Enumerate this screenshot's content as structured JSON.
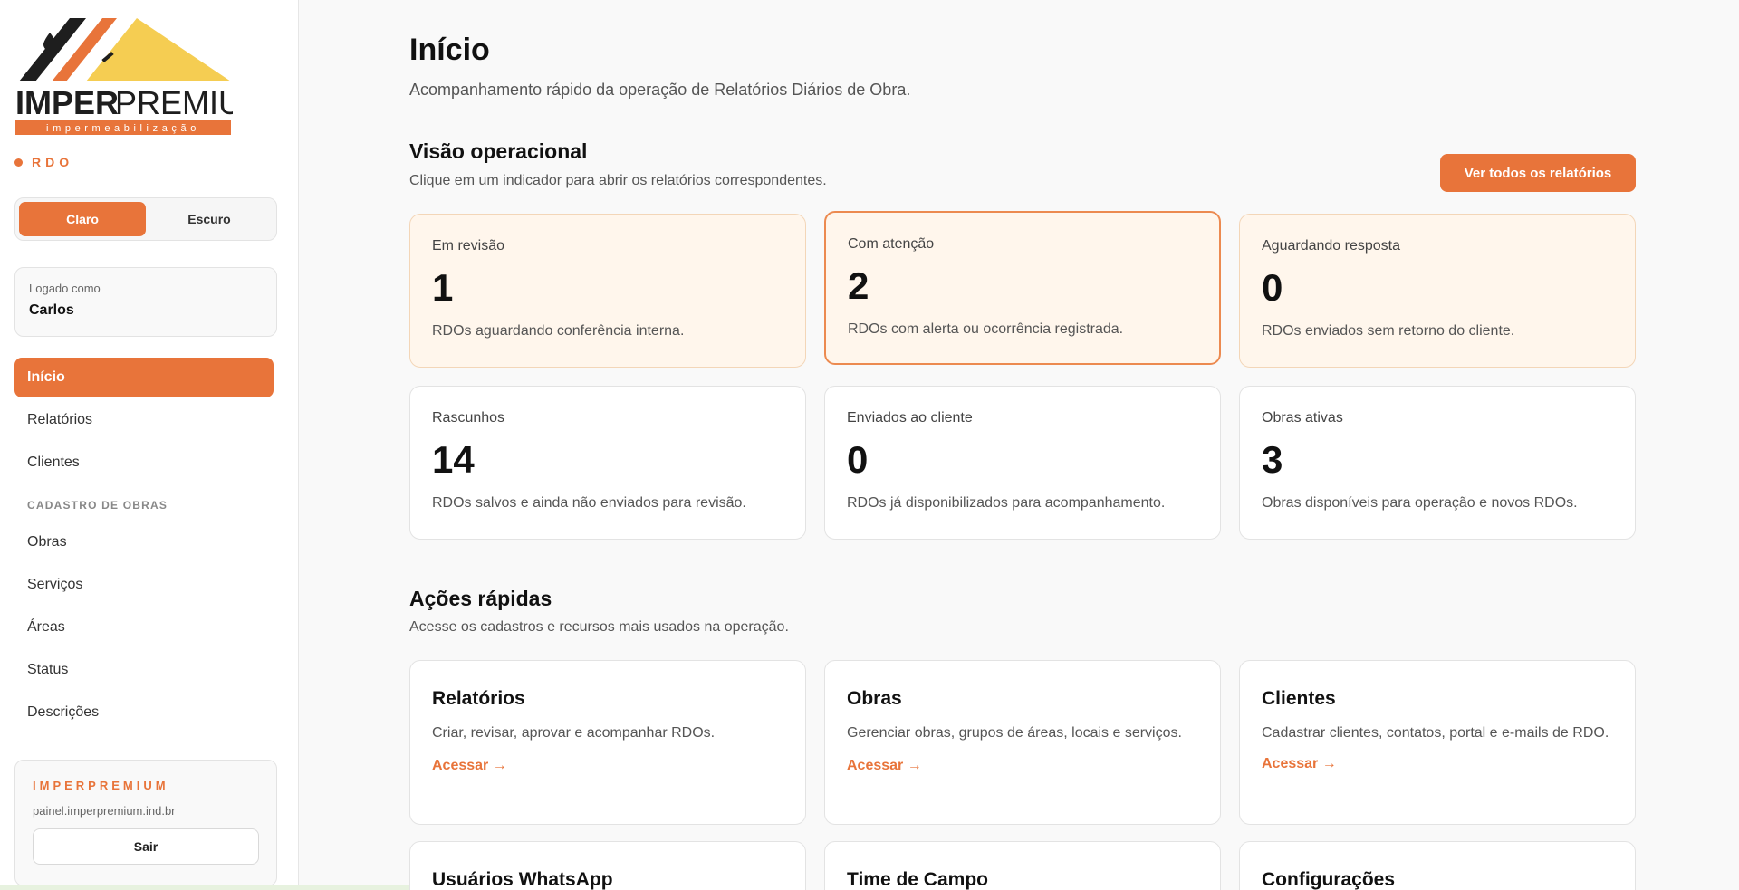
{
  "brand": {
    "logo_main": "IMPER",
    "logo_secondary": "PREMIUM",
    "logo_tagline": "impermeabilização",
    "module": "RDO"
  },
  "theme": {
    "light_label": "Claro",
    "dark_label": "Escuro",
    "selected": "Claro"
  },
  "user": {
    "label": "Logado como",
    "name": "Carlos"
  },
  "nav": {
    "items": [
      {
        "label": "Início",
        "active": true
      },
      {
        "label": "Relatórios"
      },
      {
        "label": "Clientes"
      }
    ],
    "section_label": "CADASTRO DE OBRAS",
    "section_items": [
      {
        "label": "Obras"
      },
      {
        "label": "Serviços"
      },
      {
        "label": "Áreas"
      },
      {
        "label": "Status"
      },
      {
        "label": "Descrições"
      }
    ]
  },
  "company": {
    "name": "IMPERPREMIUM",
    "url": "painel.imperpremium.ind.br",
    "logout_label": "Sair"
  },
  "header": {
    "title": "Início",
    "subtitle": "Acompanhamento rápido da operação de Relatórios Diários de Obra."
  },
  "operational": {
    "title": "Visão operacional",
    "subtitle": "Clique em um indicador para abrir os relatórios correspondentes.",
    "view_all_label": "Ver todos os relatórios",
    "stats": [
      {
        "label": "Em revisão",
        "value": "1",
        "desc": "RDOs aguardando conferência interna."
      },
      {
        "label": "Com atenção",
        "value": "2",
        "desc": "RDOs com alerta ou ocorrência registrada."
      },
      {
        "label": "Aguardando resposta",
        "value": "0",
        "desc": "RDOs enviados sem retorno do cliente."
      },
      {
        "label": "Rascunhos",
        "value": "14",
        "desc": "RDOs salvos e ainda não enviados para revisão."
      },
      {
        "label": "Enviados ao cliente",
        "value": "0",
        "desc": "RDOs já disponibilizados para acompanhamento."
      },
      {
        "label": "Obras ativas",
        "value": "3",
        "desc": "Obras disponíveis para operação e novos RDOs."
      }
    ]
  },
  "quick_actions": {
    "title": "Ações rápidas",
    "subtitle": "Acesse os cadastros e recursos mais usados na operação.",
    "link_label": "Acessar →",
    "items": [
      {
        "title": "Relatórios",
        "desc": "Criar, revisar, aprovar e acompanhar RDOs."
      },
      {
        "title": "Obras",
        "desc": "Gerenciar obras, grupos de áreas, locais e serviços."
      },
      {
        "title": "Clientes",
        "desc": "Cadastrar clientes, contatos, portal e e-mails de RDO."
      },
      {
        "title": "Usuários WhatsApp"
      },
      {
        "title": "Time de Campo"
      },
      {
        "title": "Configurações"
      }
    ]
  },
  "colors": {
    "accent": "#e8743a",
    "warn_bg": "#fff6ec",
    "logo_dark": "#1e1e1e",
    "logo_yellow": "#f5cd52"
  }
}
